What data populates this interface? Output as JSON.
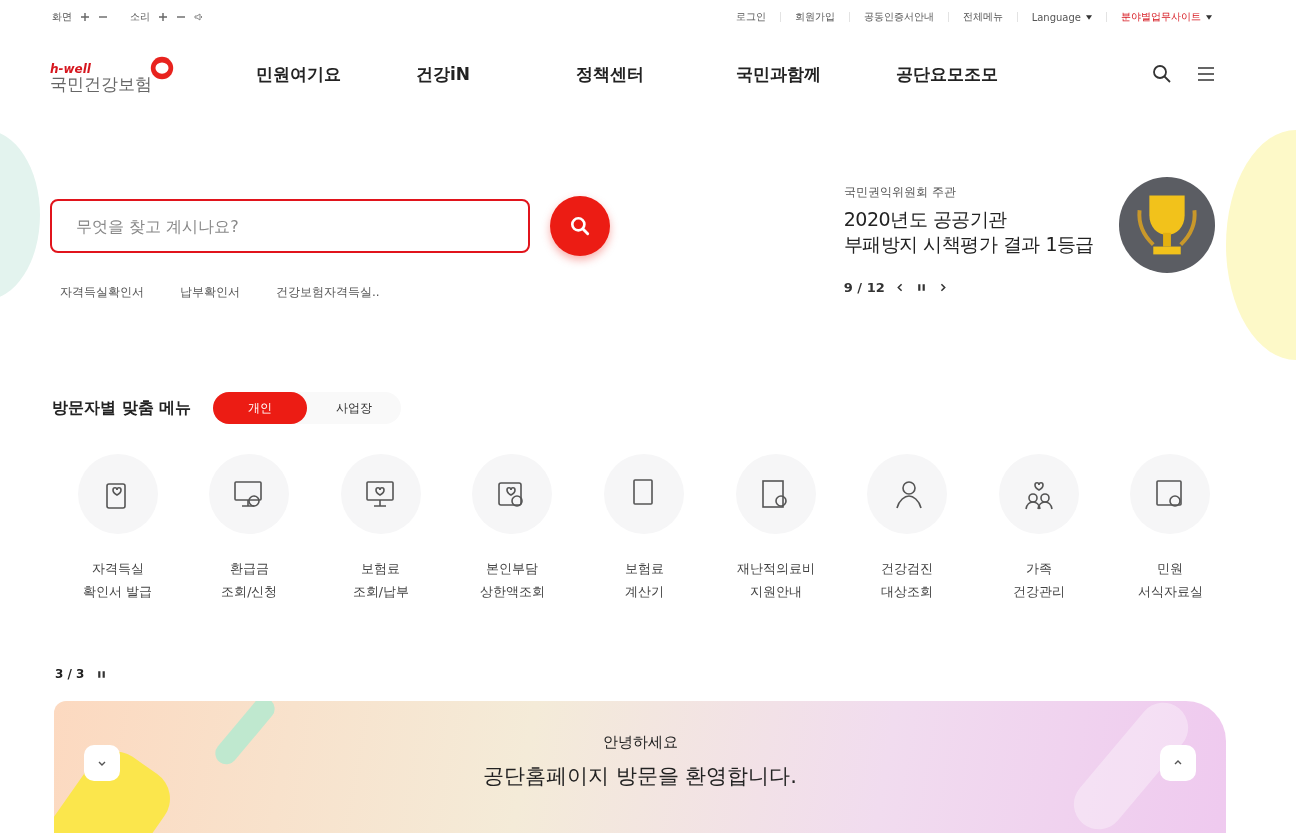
{
  "top_bar": {
    "screen_label": "화면",
    "sound_label": "소리",
    "links": [
      "로그인",
      "회원가입",
      "공동인증서안내",
      "전체메뉴"
    ],
    "language": "Language",
    "family_site": "분야별업무사이트"
  },
  "logo": {
    "tagline": "h-well",
    "name": "국민건강보험"
  },
  "nav": [
    "민원여기요",
    "건강iN",
    "정책센터",
    "국민과함께",
    "공단요모조모"
  ],
  "search": {
    "placeholder": "무엇을 찾고 계시나요?",
    "quick_links": [
      "자격득실확인서",
      "납부확인서",
      "건강보험자격득실.."
    ]
  },
  "award": {
    "organizer": "국민권익위원회 주관",
    "title": "2020년도 공공기관\n부패방지 시책평가 결과 1등급",
    "pager": "9 / 12"
  },
  "custom_menu": {
    "title": "방문자별 맞춤 메뉴",
    "tabs": [
      {
        "label": "개인",
        "selected": true
      },
      {
        "label": "사업장",
        "selected": false
      }
    ],
    "items": [
      "자격득실\n확인서 발급",
      "환급금\n조회/신청",
      "보험료\n조회/납부",
      "본인부담\n상한액조회",
      "보험료\n계산기",
      "재난적의료비\n지원안내",
      "건강검진\n대상조회",
      "가족\n건강관리",
      "민원\n서식자료실"
    ],
    "pager": "3 / 3"
  },
  "banner": {
    "greeting": "안녕하세요",
    "message": "공단홈페이지 방문을 환영합니다."
  }
}
